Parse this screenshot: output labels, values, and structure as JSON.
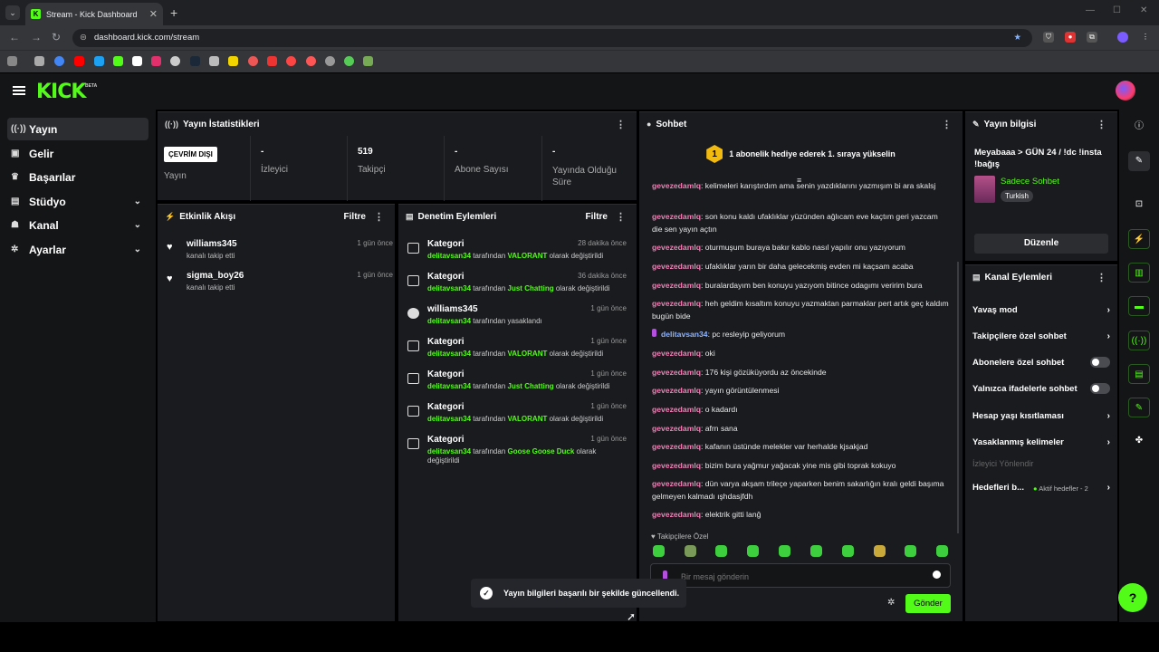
{
  "browser": {
    "tab_title": "Stream - Kick Dashboard",
    "url": "dashboard.kick.com/stream"
  },
  "brand": {
    "logo": "KICK",
    "beta": "BETA",
    "accent": "#53fc18"
  },
  "sidebar": {
    "items": [
      {
        "label": "Yayın",
        "icon": "broadcast-icon"
      },
      {
        "label": "Gelir",
        "icon": "money-icon"
      },
      {
        "label": "Başarılar",
        "icon": "trophy-icon"
      },
      {
        "label": "Stüdyo",
        "icon": "studio-icon"
      },
      {
        "label": "Kanal",
        "icon": "channel-icon"
      },
      {
        "label": "Ayarlar",
        "icon": "gear-icon"
      }
    ]
  },
  "stats": {
    "title": "Yayın İstatistikleri",
    "badge": "ÇEVRİM DIŞI",
    "items": [
      {
        "value": "",
        "label": "Yayın"
      },
      {
        "value": "-",
        "label": "İzleyici"
      },
      {
        "value": "519",
        "label": "Takipçi"
      },
      {
        "value": "-",
        "label": "Abone Sayısı"
      },
      {
        "value": "-",
        "label": "Yayında Olduğu Süre"
      }
    ]
  },
  "activity": {
    "title": "Etkinlik Akışı",
    "filter": "Filtre",
    "items": [
      {
        "name": "williams345",
        "sub": "kanalı takip etti",
        "time": "1 gün önce"
      },
      {
        "name": "sigma_boy26",
        "sub": "kanalı takip etti",
        "time": "1 gün önce"
      }
    ]
  },
  "moderation": {
    "title": "Denetim Eylemleri",
    "filter": "Filtre",
    "items": [
      {
        "title": "Kategori",
        "user": "delitavsan34",
        "mid": " tarafından ",
        "target": "VALORANT",
        "end": " olarak değiştirildi",
        "time": "28 dakika önce"
      },
      {
        "title": "Kategori",
        "user": "delitavsan34",
        "mid": " tarafından ",
        "target": "Just Chatting",
        "end": " olarak değiştirildi",
        "time": "36 dakika önce"
      },
      {
        "title": "williams345",
        "user": "delitavsan34",
        "mid": " tarafından yasaklandı",
        "target": "",
        "end": "",
        "time": "1 gün önce"
      },
      {
        "title": "Kategori",
        "user": "delitavsan34",
        "mid": " tarafından ",
        "target": "VALORANT",
        "end": " olarak değiştirildi",
        "time": "1 gün önce"
      },
      {
        "title": "Kategori",
        "user": "delitavsan34",
        "mid": " tarafından ",
        "target": "Just Chatting",
        "end": " olarak değiştirildi",
        "time": "1 gün önce"
      },
      {
        "title": "Kategori",
        "user": "delitavsan34",
        "mid": " tarafından ",
        "target": "VALORANT",
        "end": " olarak değiştirildi",
        "time": "1 gün önce"
      },
      {
        "title": "Kategori",
        "user": "delitavsan34",
        "mid": " tarafından ",
        "target": "Goose Goose Duck",
        "end": " olarak değiştirildi",
        "time": "1 gün önce"
      }
    ]
  },
  "chat": {
    "title": "Sohbet",
    "banner": "1 abonelik hediye ederek 1. sıraya yükselin",
    "banner_rank": "1",
    "messages": [
      {
        "user": "gevezedamlq",
        "text": "kelimeleri karıştırdım ama senin yazdıklarını yazmışım bi ara skalsj"
      },
      {
        "user": "gevezedamlq",
        "text": "son konu kaldı ufaklıklar yüzünden ağlıcam eve kaçtım geri yazcam die sen yayın açtın"
      },
      {
        "user": "gevezedamlq",
        "text": "oturmuşum buraya bakır kablo nasıl yapılır onu yazıyorum"
      },
      {
        "user": "gevezedamlq",
        "text": "ufaklıklar yarın bir daha gelecekmiş evden mi kaçsam acaba"
      },
      {
        "user": "gevezedamlq",
        "text": "buralardayım ben konuyu yazıyom bitince odagımı veririm bura"
      },
      {
        "user": "gevezedamlq",
        "text": "heh geldim kısaltım konuyu yazmaktan parmaklar pert artık geç kaldım bugün bide"
      },
      {
        "user": "delitavsan34",
        "text": "pc resleyip geliyorum"
      },
      {
        "user": "gevezedamlq",
        "text": "oki"
      },
      {
        "user": "gevezedamlq",
        "text": "176 kişi gözüküyordu az öncekinde"
      },
      {
        "user": "gevezedamlq",
        "text": "yayın görüntülenmesi"
      },
      {
        "user": "gevezedamlq",
        "text": "o kadardı"
      },
      {
        "user": "gevezedamlq",
        "text": "afrn sana"
      },
      {
        "user": "gevezedamlq",
        "text": "kafanın üstünde melekler var herhalde kjsakjad"
      },
      {
        "user": "gevezedamlq",
        "text": "bizim bura yağmur yağacak yine mis gibi toprak kokuyo"
      },
      {
        "user": "gevezedamlq",
        "text": "dün varya akşam trileçe yaparken benim sakarlığın kralı geldi başıma gelmeyen kalmadı ışhdasjfdh"
      },
      {
        "user": "gevezedamlq",
        "text": "elektrik gitti lanğ"
      }
    ],
    "followers_only": "Takipçilere Özel",
    "placeholder": "Bir mesaj gönderin",
    "send": "Gönder"
  },
  "stream_info": {
    "title": "Yayın bilgisi",
    "stream_title": "Meyabaaa > GÜN 24 / !dc !insta !bağış",
    "category": "Sadece Sohbet",
    "language": "Turkish",
    "edit": "Düzenle"
  },
  "channel_actions": {
    "title": "Kanal Eylemleri",
    "items": [
      {
        "label": "Yavaş mod",
        "kind": "chevron"
      },
      {
        "label": "Takipçilere özel sohbet",
        "kind": "chevron"
      },
      {
        "label": "Abonelere özel sohbet",
        "kind": "toggle"
      },
      {
        "label": "Yalnızca ifadelerle sohbet",
        "kind": "toggle"
      },
      {
        "label": "Hesap yaşı kısıtlaması",
        "kind": "chevron"
      },
      {
        "label": "Yasaklanmış kelimeler",
        "kind": "chevron"
      }
    ],
    "section": "İzleyici Yönlendir",
    "goals": "Hedefleri b...",
    "goals_status": "Aktif hedefler - 2"
  },
  "toast": {
    "text": "Yayın bilgileri başarılı bir şekilde güncellendi."
  }
}
